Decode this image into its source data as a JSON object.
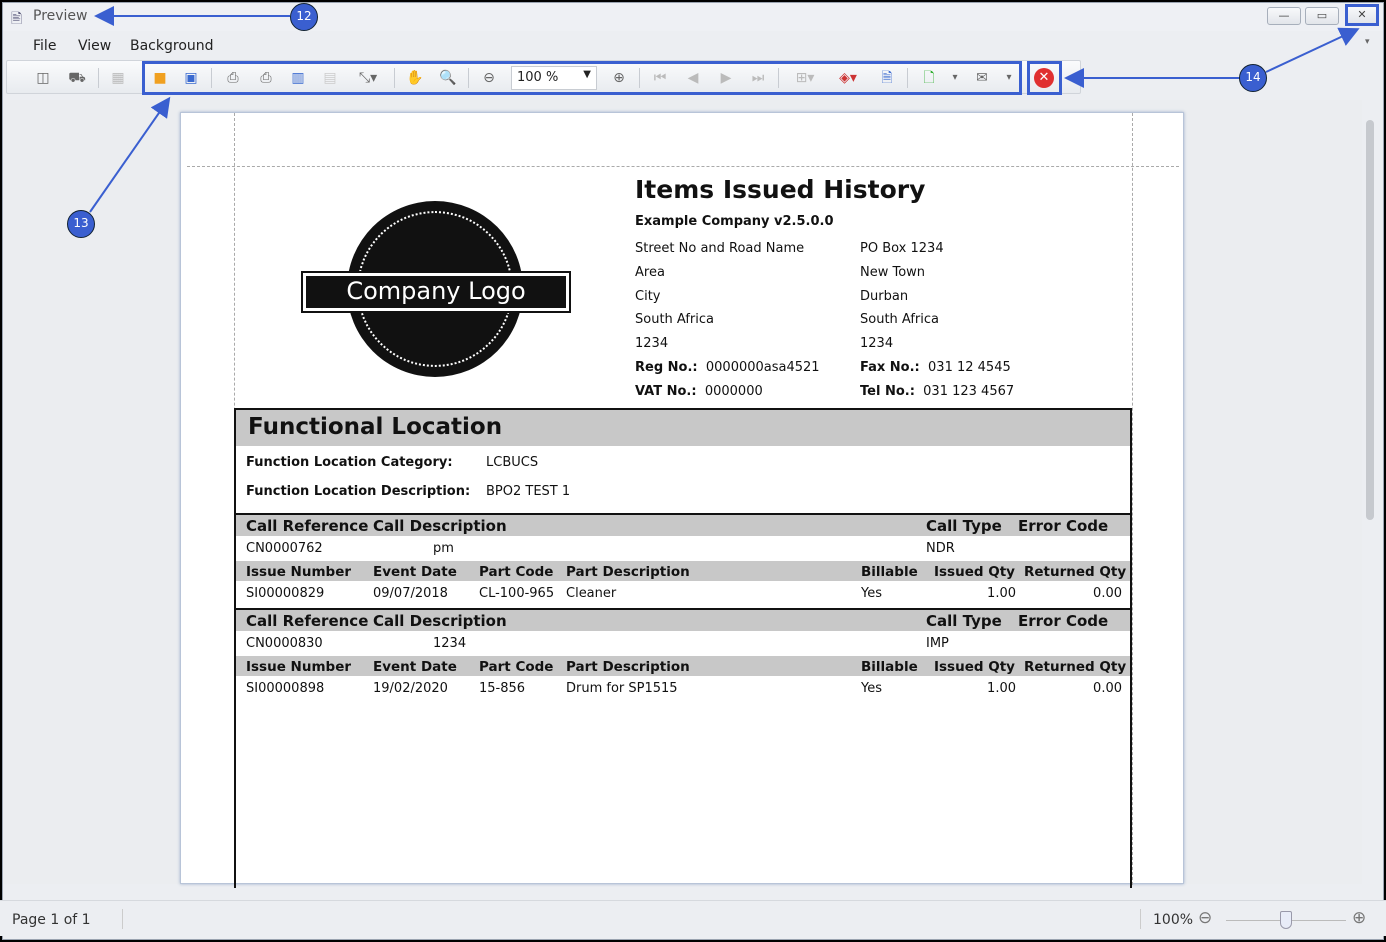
{
  "window": {
    "title": "Preview",
    "controls": [
      "minimize",
      "maximize",
      "close"
    ]
  },
  "menu": [
    "File",
    "View",
    "Background"
  ],
  "toolbar": {
    "zoom_value": "100 %"
  },
  "report": {
    "title": "Items Issued History",
    "company": "Example Company v2.5.0.0",
    "logo_text": "Company Logo",
    "address_left": [
      "Street No and Road Name",
      "Area",
      "City",
      "South Africa",
      "1234"
    ],
    "address_right": [
      "PO Box 1234",
      "New Town",
      "Durban",
      "South Africa",
      "1234"
    ],
    "reg_label": "Reg No.:",
    "reg_value": "0000000asa4521",
    "vat_label": "VAT No.:",
    "vat_value": "0000000",
    "fax_label": "Fax No.:",
    "fax_value": "031 12 4545",
    "tel_label": "Tel No.:",
    "tel_value": "031 123 4567",
    "section_title": "Functional Location",
    "category_label": "Function Location Category:",
    "category_value": "LCBUCS",
    "description_label": "Function Location Description:",
    "description_value": "BPO2 TEST 1",
    "call_headers": [
      "Call Reference",
      "Call Description",
      "Call Type",
      "Error Code"
    ],
    "issue_headers": [
      "Issue Number",
      "Event Date",
      "Part Code",
      "Part Description",
      "Billable",
      "Issued Qty",
      "Returned Qty"
    ],
    "calls": [
      {
        "ref": "CN0000762",
        "desc": "pm",
        "type": "NDR",
        "error": "",
        "issues": [
          {
            "number": "SI00000829",
            "date": "09/07/2018",
            "part": "CL-100-965",
            "part_desc": "Cleaner",
            "billable": "Yes",
            "issued": "1.00",
            "returned": "0.00"
          }
        ]
      },
      {
        "ref": "CN0000830",
        "desc": "1234",
        "type": "IMP",
        "error": "",
        "issues": [
          {
            "number": "SI00000898",
            "date": "19/02/2020",
            "part": "15-856",
            "part_desc": "Drum for SP1515",
            "billable": "Yes",
            "issued": "1.00",
            "returned": "0.00"
          }
        ]
      }
    ]
  },
  "status": {
    "page": "Page 1 of 1",
    "zoom": "100%",
    "zoom_fraction": 0.5
  },
  "annotations": [
    "12",
    "13",
    "14"
  ],
  "colors": {
    "annotation": "#3a5fd0",
    "close_red": "#e03030"
  }
}
